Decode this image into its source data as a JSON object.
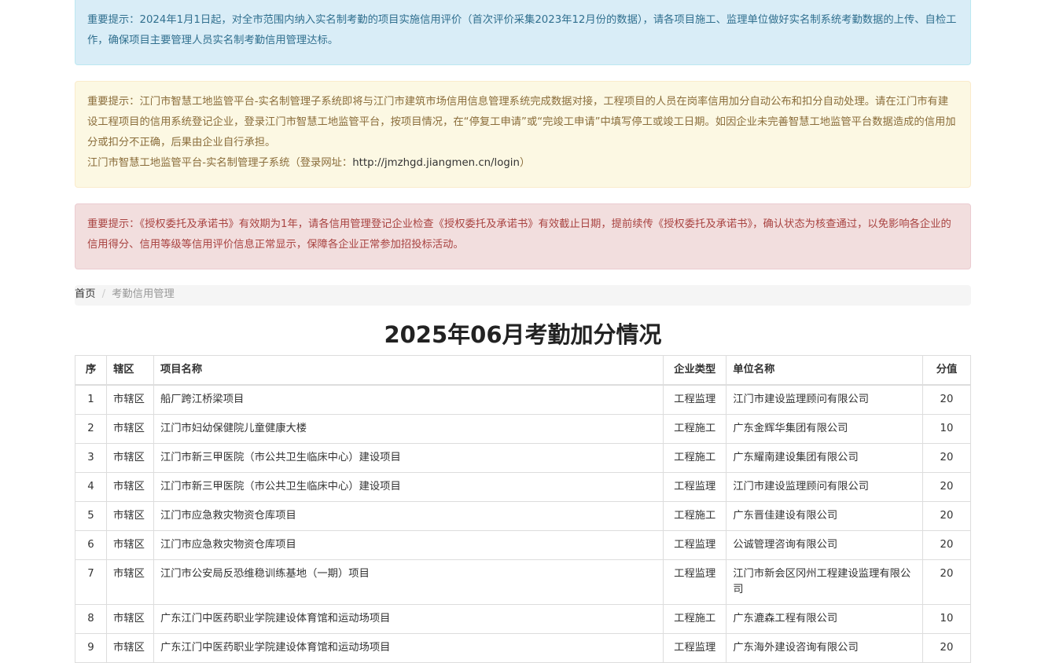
{
  "notices": {
    "info": "重要提示：2024年1月1日起，对全市范围内纳入实名制考勤的项目实施信用评价（首次评价采集2023年12月份的数据），请各项目施工、监理单位做好实名制系统考勤数据的上传、自检工作，确保项目主要管理人员实名制考勤信用管理达标。",
    "warning_main": "重要提示：江门市智慧工地监管平台-实名制管理子系统即将与江门市建筑市场信用信息管理系统完成数据对接，工程项目的人员在岗率信用加分自动公布和扣分自动处理。请在江门市有建设工程项目的信用系统登记企业，登录江门市智慧工地监管平台，按项目情况，在“停复工申请”或“完竣工申请”中填写停工或竣工日期。如因企业未完善智慧工地监管平台数据造成的信用加分或扣分不正确，后果由企业自行承担。",
    "warning_link_prefix": "江门市智慧工地监管平台-实名制管理子系统（登录网址：",
    "warning_link": "http://jmzhgd.jiangmen.cn/login",
    "warning_link_suffix": "）",
    "danger": "重要提示：《授权委托及承诺书》有效期为1年，请各信用管理登记企业检查《授权委托及承诺书》有效截止日期，提前续传《授权委托及承诺书》，确认状态为核查通过，以免影响各企业的信用得分、信用等级等信用评价信息正常显示，保障各企业正常参加招投标活动。"
  },
  "breadcrumb": {
    "home": "首页",
    "separator": "/",
    "current": "考勤信用管理"
  },
  "title": "2025年06月考勤加分情况",
  "table": {
    "headers": [
      "序",
      "辖区",
      "项目名称",
      "企业类型",
      "单位名称",
      "分值"
    ],
    "rows": [
      [
        "1",
        "市辖区",
        "船厂跨江桥梁项目",
        "工程监理",
        "江门市建设监理顾问有限公司",
        "20"
      ],
      [
        "2",
        "市辖区",
        "江门市妇幼保健院儿童健康大楼",
        "工程施工",
        "广东金辉华集团有限公司",
        "10"
      ],
      [
        "3",
        "市辖区",
        "江门市新三甲医院（市公共卫生临床中心）建设项目",
        "工程施工",
        "广东耀南建设集团有限公司",
        "20"
      ],
      [
        "4",
        "市辖区",
        "江门市新三甲医院（市公共卫生临床中心）建设项目",
        "工程监理",
        "江门市建设监理顾问有限公司",
        "20"
      ],
      [
        "5",
        "市辖区",
        "江门市应急救灾物资仓库项目",
        "工程施工",
        "广东晋佳建设有限公司",
        "20"
      ],
      [
        "6",
        "市辖区",
        "江门市应急救灾物资仓库项目",
        "工程监理",
        "公诚管理咨询有限公司",
        "20"
      ],
      [
        "7",
        "市辖区",
        "江门市公安局反恐维稳训练基地（一期）项目",
        "工程监理",
        "江门市新会区冈州工程建设监理有限公司",
        "20"
      ],
      [
        "8",
        "市辖区",
        "广东江门中医药职业学院建设体育馆和运动场项目",
        "工程施工",
        "广东漉森工程有限公司",
        "10"
      ],
      [
        "9",
        "市辖区",
        "广东江门中医药职业学院建设体育馆和运动场项目",
        "工程监理",
        "广东海外建设咨询有限公司",
        "20"
      ]
    ]
  }
}
